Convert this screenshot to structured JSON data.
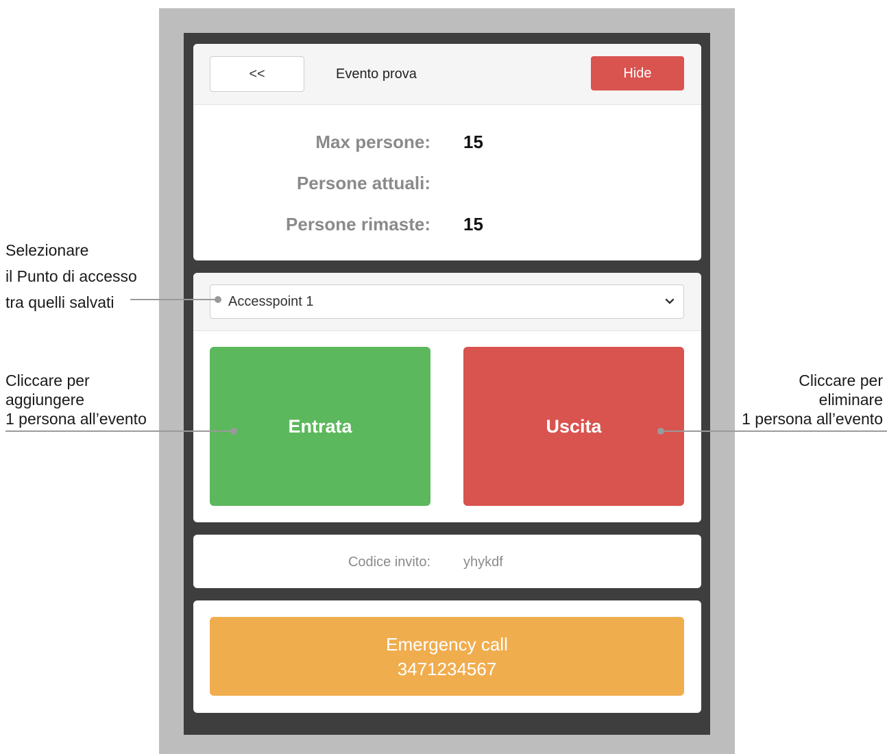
{
  "header": {
    "back_label": "<<",
    "title": "Evento prova",
    "hide_label": "Hide"
  },
  "stats": {
    "max_label": "Max persone:",
    "max_value": "15",
    "current_label": "Persone attuali:",
    "current_value": "",
    "remaining_label": "Persone rimaste:",
    "remaining_value": "15"
  },
  "access_point": {
    "selected": "Accesspoint 1"
  },
  "actions": {
    "entrata_label": "Entrata",
    "uscita_label": "Uscita"
  },
  "invite": {
    "label": "Codice invito:",
    "code": "yhykdf"
  },
  "emergency": {
    "title": "Emergency call",
    "number": "3471234567"
  },
  "annotations": {
    "select_lines": [
      "Selezionare",
      "il Punto di accesso",
      "tra quelli salvati"
    ],
    "entrata_lines": [
      "Cliccare per",
      "aggiungere",
      "1 persona all’evento"
    ],
    "uscita_lines": [
      "Cliccare per",
      "eliminare",
      "1 persona all’evento"
    ]
  },
  "colors": {
    "success": "#5cb85c",
    "danger": "#d9534f",
    "warning": "#f0ad4e",
    "screen_bg": "#3e3e3e"
  }
}
